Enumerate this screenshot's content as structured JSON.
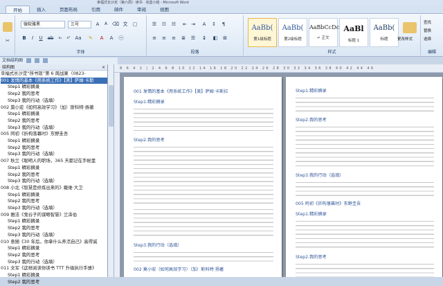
{
  "window": {
    "title": "幸福式长沙定（第六周）· 读书 · 完善小结 - Microsoft Word"
  },
  "tabs": [
    "开始",
    "插入",
    "页面布局",
    "引用",
    "邮件",
    "审阅",
    "视图"
  ],
  "ribbon": {
    "font_name": "微软雅黑",
    "font_size": "三号",
    "groups": {
      "font": "字体",
      "paragraph": "段落",
      "styles": "样式",
      "edit": "编辑"
    },
    "styles": [
      {
        "sample": "AaBb(",
        "name": "第1级标题"
      },
      {
        "sample": "AaBb(",
        "name": "第2级标题"
      },
      {
        "sample": "AaBbCcDc",
        "name": "↵ 正文"
      },
      {
        "sample": "AaBl",
        "name": "标题 1"
      },
      {
        "sample": "AaBb(",
        "name": "标题"
      }
    ],
    "change_styles": "更改样式",
    "find": "查找",
    "replace": "替换",
    "select": "选择"
  },
  "toolbar2": {
    "label": "文档结构图"
  },
  "nav": {
    "header": "结构图",
    "items": [
      {
        "text": "幸福式长沙定“所书现”第 6 周战果（0823-",
        "level": 1
      },
      {
        "text": "001 发情的基本《用系统工作》【美】萨姆·卡斯",
        "level": 1,
        "selected": true
      },
      {
        "text": "Step1 精彩摘录",
        "level": 2
      },
      {
        "text": "Step2 我的思考",
        "level": 2
      },
      {
        "text": "Step3 我的行动（选填）",
        "level": 2
      },
      {
        "text": "002 莫小宏《如何高效学习》（加）斯科特·扬著",
        "level": 1
      },
      {
        "text": "Step1 精彩摘录",
        "level": 2
      },
      {
        "text": "Step2 我的思考",
        "level": 2
      },
      {
        "text": "Step3 我的行动（选填）",
        "level": 2
      },
      {
        "text": "005 阿初《折构落幕时》东野圭吾",
        "level": 1
      },
      {
        "text": "Step1 精彩摘录",
        "level": 2
      },
      {
        "text": "Step2 我的思考",
        "level": 2
      },
      {
        "text": "Step3 我的行动（选填）",
        "level": 2
      },
      {
        "text": "007 秋兰《聪明人的职场，365 天都记在手帐里",
        "level": 1
      },
      {
        "text": "Step1 精彩摘录",
        "level": 2
      },
      {
        "text": "Step2 我的思考",
        "level": 2
      },
      {
        "text": "Step3 我的行动（选填）",
        "level": 2
      },
      {
        "text": "008 小北《智慧是修炼出来的》戴维·大卫",
        "level": 1
      },
      {
        "text": "Step1 精彩摘录",
        "level": 2
      },
      {
        "text": "Step2 我的思考",
        "level": 2
      },
      {
        "text": "Step3 我的行动（选填）",
        "level": 2
      },
      {
        "text": "009 雅洁《鬼谷子的谋略智慧》兰泽伯",
        "level": 1
      },
      {
        "text": "Step1 精彩摘录",
        "level": 2
      },
      {
        "text": "Step2 我的思考",
        "level": 2
      },
      {
        "text": "Step3 我的行动（选填）",
        "level": 2
      },
      {
        "text": "010 意随《30 年后，你拿什么养活自己》高得诚",
        "level": 1
      },
      {
        "text": "Step1 精彩摘录",
        "level": 2
      },
      {
        "text": "Step2 我的思考",
        "level": 2
      },
      {
        "text": "Step3 我的行动（选填）",
        "level": 2
      },
      {
        "text": "011 文军《这样阅读你读书 TTT 升级执行手册》",
        "level": 1
      },
      {
        "text": "Step1 精彩摘录",
        "level": 2
      },
      {
        "text": "Step2 我的思考",
        "level": 2
      }
    ]
  },
  "ruler": "8 6 4 2 | 2 4 6 8 10 12 14 16 18 20 22 24 26 28 30 32 34 36 38 40 42 44 46",
  "page1": {
    "title": "001 发情的基本《用系统工作》【美】萨姆·卡斯拉",
    "step1": "Step1.精彩摘录",
    "step2": "Step2.我的思考",
    "step3": "Step3.我的行动（选填）",
    "next_title": "002 莫小宏（如何高效学习）（加）斯科特·扬著"
  },
  "page2": {
    "step1": "Step1.精彩摘录",
    "step2": "Step2.我的思考",
    "step3": "Step3.我的行动（选填）",
    "next_title": "005 阿初《折构落幕时》东野圭吾",
    "step1b": "Step1.精彩摘录",
    "step2b": "Step2.我的思考"
  }
}
